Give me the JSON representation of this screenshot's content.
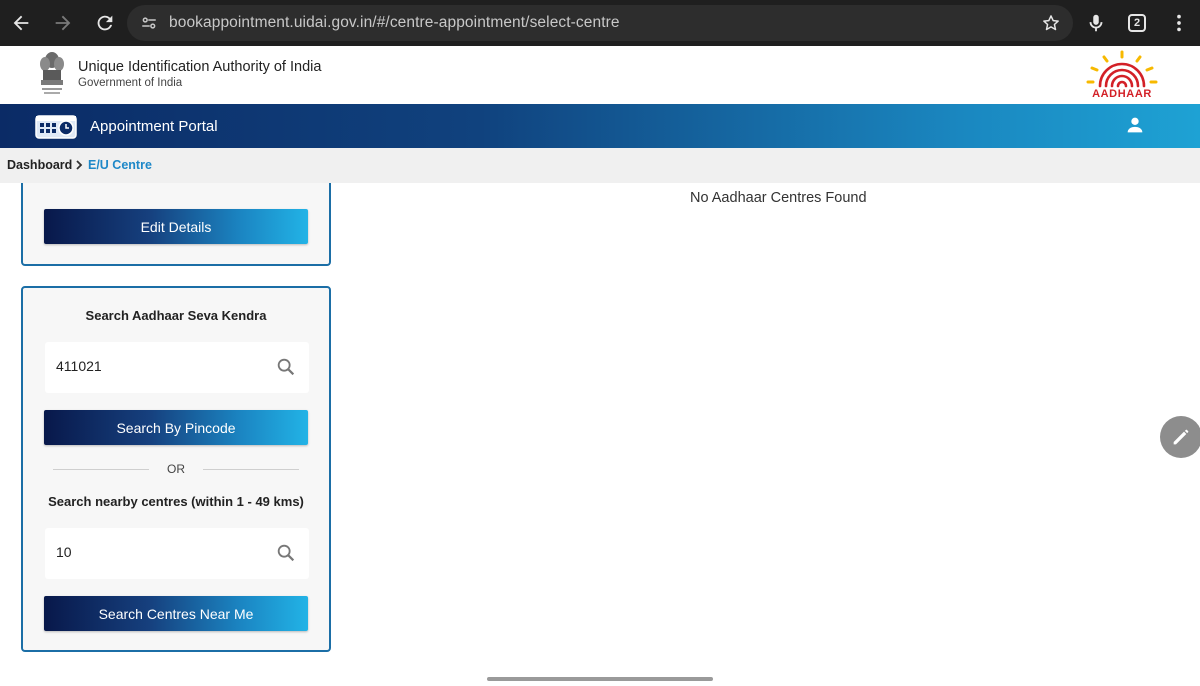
{
  "browser": {
    "url": "bookappointment.uidai.gov.in/#/centre-appointment/select-centre",
    "tab_count": "2"
  },
  "header": {
    "org_name": "Unique Identification Authority of India",
    "org_sub": "Government of India",
    "logo_text": "AADHAAR"
  },
  "portal": {
    "title": "Appointment Portal"
  },
  "breadcrumb": {
    "dashboard": "Dashboard",
    "current": "E/U Centre"
  },
  "details_panel": {
    "edit_label": "Edit Details"
  },
  "search_panel": {
    "heading": "Search Aadhaar Seva Kendra",
    "pincode_value": "411021",
    "pincode_button": "Search By Pincode",
    "or_label": "OR",
    "nearby_heading": "Search nearby centres (within 1 - 49 kms)",
    "distance_value": "10",
    "nearby_button": "Search Centres Near Me"
  },
  "results": {
    "message": "No Aadhaar Centres Found"
  },
  "colors": {
    "accent": "#1e88c8",
    "panel_border": "#1b6ea6",
    "logo_red": "#d32027",
    "logo_yellow": "#f7b900"
  },
  "icons": [
    "back-arrow-icon",
    "forward-arrow-icon",
    "reload-icon",
    "site-info-icon",
    "star-icon",
    "mic-icon",
    "more-vert-icon",
    "emblem-icon",
    "aadhaar-logo-icon",
    "calendar-clock-icon",
    "user-icon",
    "chevron-right-icon",
    "search-icon",
    "pencil-icon"
  ]
}
